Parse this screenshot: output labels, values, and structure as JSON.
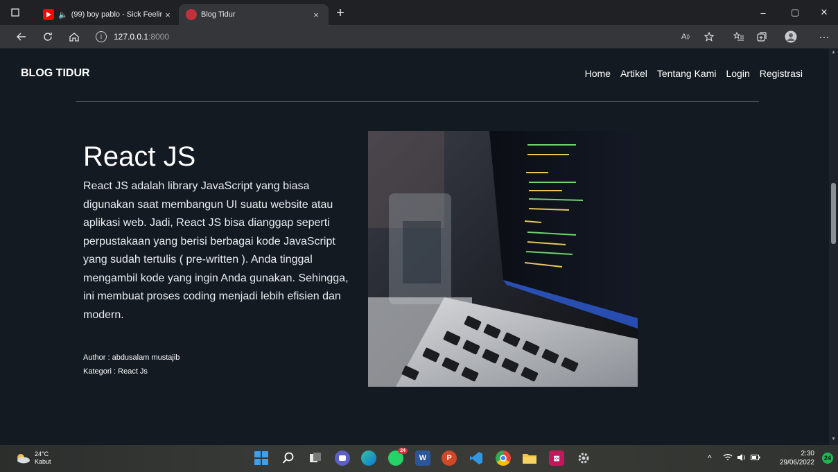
{
  "browser": {
    "tabs": [
      {
        "title": "(99) boy pablo - Sick Feelin",
        "close": "×",
        "active": false
      },
      {
        "title": "Blog Tidur",
        "close": "×",
        "active": true
      }
    ],
    "new_tab": "+",
    "url_host": "127.0.0.1",
    "url_port": ":8000",
    "window_controls": [
      "–",
      "▢",
      "✕"
    ]
  },
  "site": {
    "brand": "BLOG TIDUR",
    "nav": [
      "Home",
      "Artikel",
      "Tentang Kami",
      "Login",
      "Registrasi"
    ]
  },
  "post": {
    "title": "React JS",
    "body": "React JS adalah library JavaScript yang biasa digunakan saat membangun UI suatu website atau aplikasi web. Jadi, React JS bisa dianggap seperti perpustakaan yang berisi berbagai kode JavaScript yang sudah tertulis ( pre-written ). Anda tinggal mengambil kode yang ingin Anda gunakan. Sehingga, ini membuat proses coding menjadi lebih efisien dan modern.",
    "author": "Author : abdusalam mustajib",
    "category": "Kategori : React Js"
  },
  "taskbar": {
    "temperature": "24°C",
    "weather": "Kabut",
    "time": "2:30",
    "date": "29/06/2022",
    "notifications": "24",
    "whatsapp_badge": "24"
  }
}
